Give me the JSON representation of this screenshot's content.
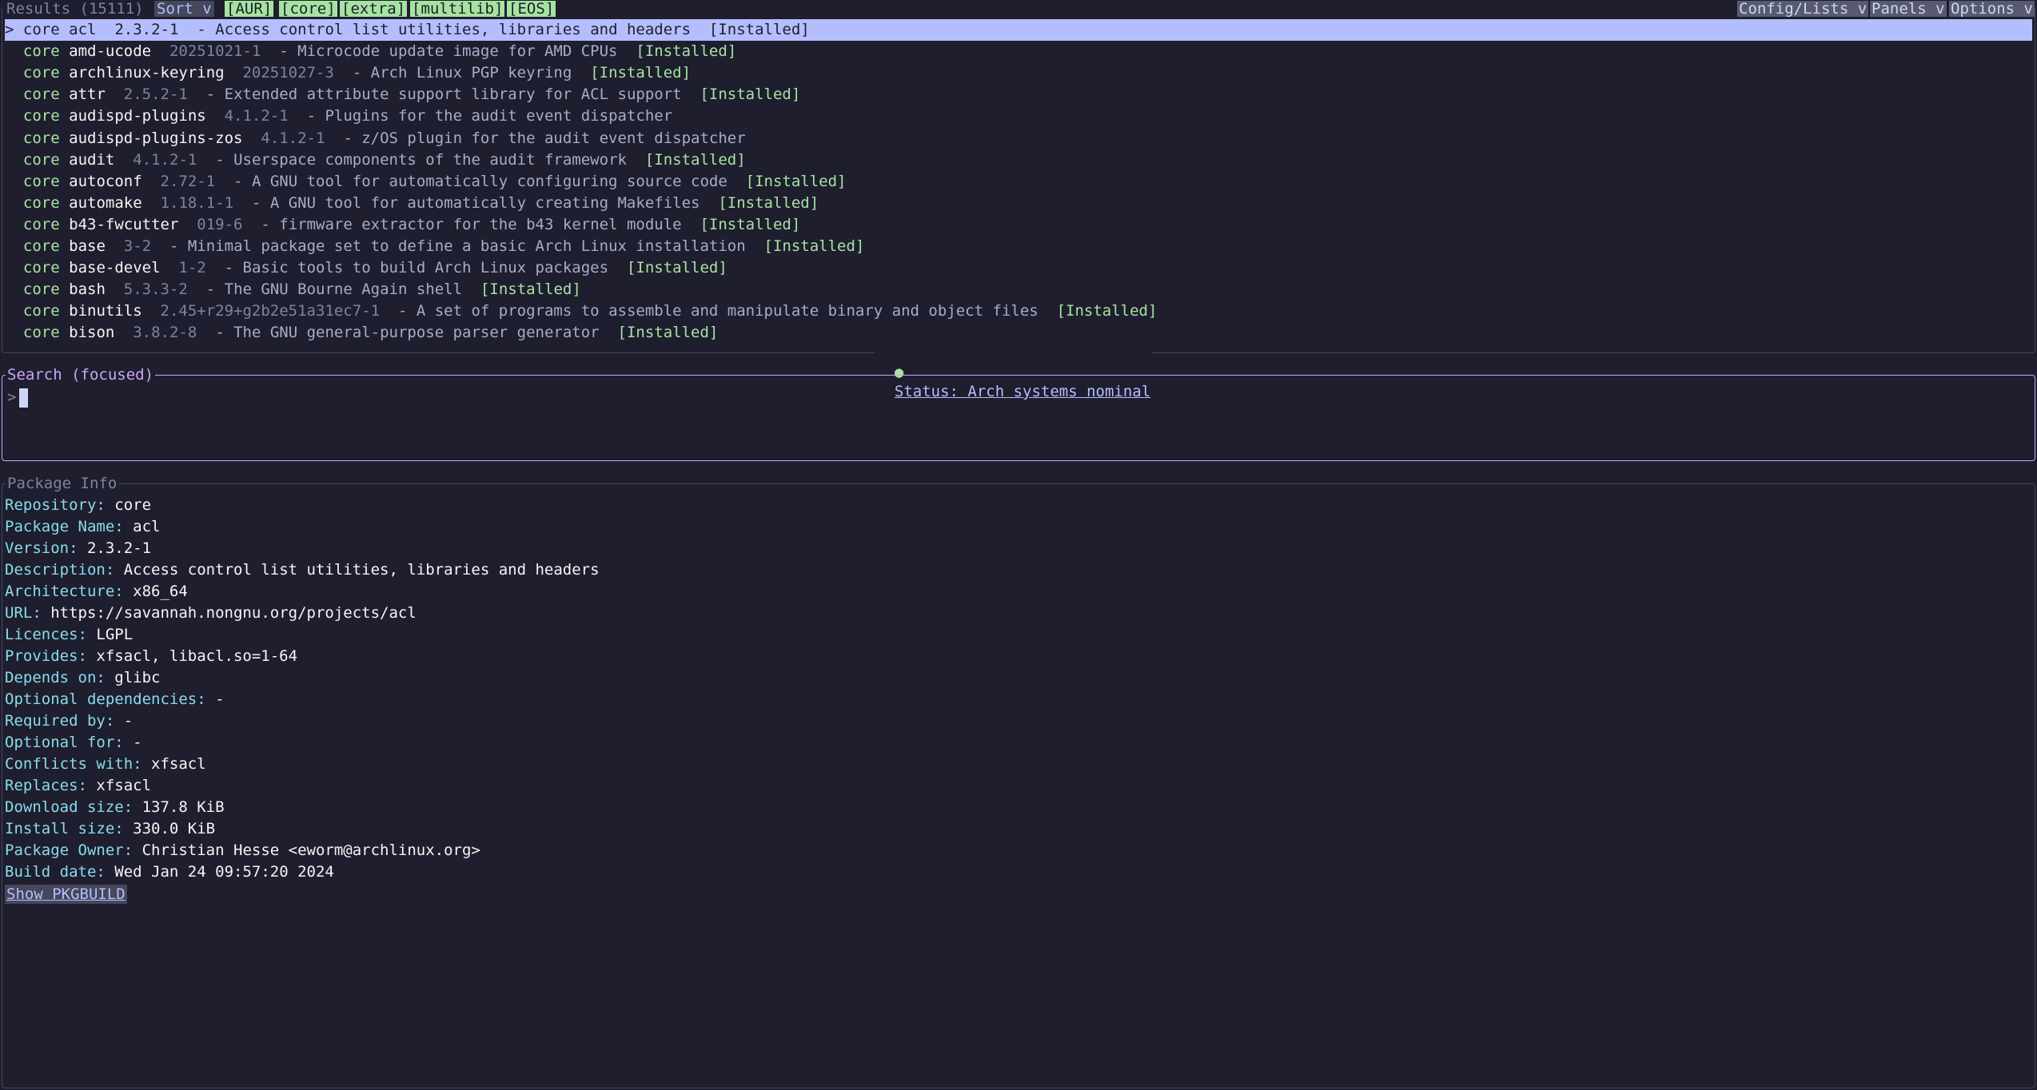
{
  "results": {
    "title": "Results (15111)",
    "sort_label": "Sort v",
    "filters": [
      "[AUR]",
      "[core]",
      "[extra]",
      "[multilib]",
      "[EOS]"
    ],
    "menus": [
      "Config/Lists v",
      "Panels v",
      "Options v"
    ],
    "cursor": ">",
    "installed_label": "[Installed]",
    "rows": [
      {
        "repo": "core",
        "name": "acl",
        "version": "2.3.2-1",
        "desc": "- Access control list utilities, libraries and headers",
        "installed": true,
        "selected": true
      },
      {
        "repo": "core",
        "name": "amd-ucode",
        "version": "20251021-1",
        "desc": "- Microcode update image for AMD CPUs",
        "installed": true
      },
      {
        "repo": "core",
        "name": "archlinux-keyring",
        "version": "20251027-3",
        "desc": "- Arch Linux PGP keyring",
        "installed": true
      },
      {
        "repo": "core",
        "name": "attr",
        "version": "2.5.2-1",
        "desc": "- Extended attribute support library for ACL support",
        "installed": true
      },
      {
        "repo": "core",
        "name": "audispd-plugins",
        "version": "4.1.2-1",
        "desc": "- Plugins for the audit event dispatcher",
        "installed": false
      },
      {
        "repo": "core",
        "name": "audispd-plugins-zos",
        "version": "4.1.2-1",
        "desc": "- z/OS plugin for the audit event dispatcher",
        "installed": false
      },
      {
        "repo": "core",
        "name": "audit",
        "version": "4.1.2-1",
        "desc": "- Userspace components of the audit framework",
        "installed": true
      },
      {
        "repo": "core",
        "name": "autoconf",
        "version": "2.72-1",
        "desc": "- A GNU tool for automatically configuring source code",
        "installed": true
      },
      {
        "repo": "core",
        "name": "automake",
        "version": "1.18.1-1",
        "desc": "- A GNU tool for automatically creating Makefiles",
        "installed": true
      },
      {
        "repo": "core",
        "name": "b43-fwcutter",
        "version": "019-6",
        "desc": "- firmware extractor for the b43 kernel module",
        "installed": true
      },
      {
        "repo": "core",
        "name": "base",
        "version": "3-2",
        "desc": "- Minimal package set to define a basic Arch Linux installation",
        "installed": true
      },
      {
        "repo": "core",
        "name": "base-devel",
        "version": "1-2",
        "desc": "- Basic tools to build Arch Linux packages",
        "installed": true
      },
      {
        "repo": "core",
        "name": "bash",
        "version": "5.3.3-2",
        "desc": "- The GNU Bourne Again shell",
        "installed": true
      },
      {
        "repo": "core",
        "name": "binutils",
        "version": "2.45+r29+g2b2e51a31ec7-1",
        "desc": "- A set of programs to assemble and manipulate binary and object files",
        "installed": true
      },
      {
        "repo": "core",
        "name": "bison",
        "version": "3.8.2-8",
        "desc": "- The GNU general-purpose parser generator",
        "installed": true
      }
    ]
  },
  "status": {
    "dot": "●",
    "text": "Status: Arch systems nominal"
  },
  "search": {
    "title": "Search (focused)",
    "prompt": ">",
    "value": ""
  },
  "info": {
    "title": "Package Info",
    "fields": [
      {
        "k": "Repository:",
        "v": "core"
      },
      {
        "k": "Package Name:",
        "v": "acl"
      },
      {
        "k": "Version:",
        "v": "2.3.2-1"
      },
      {
        "k": "Description:",
        "v": "Access control list utilities, libraries and headers"
      },
      {
        "k": "Architecture:",
        "v": "x86_64"
      },
      {
        "k": "URL:",
        "v": "https://savannah.nongnu.org/projects/acl"
      },
      {
        "k": "Licences:",
        "v": "LGPL"
      },
      {
        "k": "Provides:",
        "v": "xfsacl, libacl.so=1-64"
      },
      {
        "k": "Depends on:",
        "v": "glibc"
      },
      {
        "k": "Optional dependencies:",
        "v": "-"
      },
      {
        "k": "Required by:",
        "v": "-"
      },
      {
        "k": "Optional for:",
        "v": "-"
      },
      {
        "k": "Conflicts with:",
        "v": "xfsacl"
      },
      {
        "k": "Replaces:",
        "v": "xfsacl"
      },
      {
        "k": "Download size:",
        "v": "137.8 KiB"
      },
      {
        "k": "Install size:",
        "v": "330.0 KiB"
      },
      {
        "k": "Package Owner:",
        "v": "Christian Hesse <eworm@archlinux.org>"
      },
      {
        "k": "Build date:",
        "v": "Wed Jan 24 09:57:20 2024"
      }
    ],
    "pkgbuild_label": "Show PKGBUILD"
  }
}
